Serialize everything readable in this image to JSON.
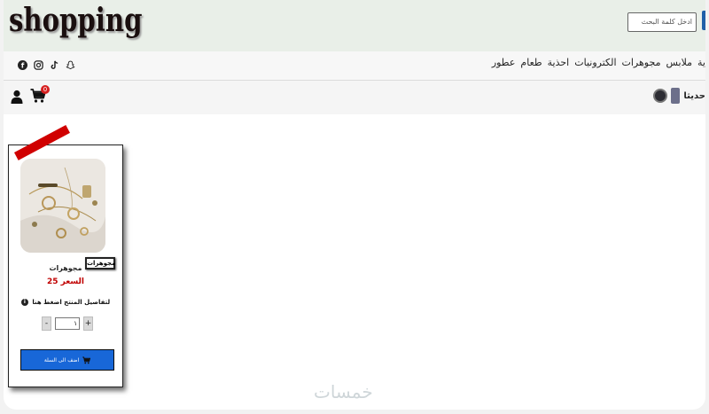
{
  "header": {
    "logo": "shopping",
    "search_placeholder": "ادخل كلمة البحث"
  },
  "nav": {
    "social": [
      "facebook-icon",
      "instagram-icon",
      "tiktok-icon",
      "snapchat-icon"
    ],
    "menu": [
      "ية",
      "ملابس",
      "مجوهرات",
      "الكترونيات",
      "احذية",
      "طعام",
      "عطور"
    ]
  },
  "userbar": {
    "cart_count": "0",
    "latest_label": "حديثا"
  },
  "product": {
    "category_tag": "مجوهرات",
    "name": "مجوهرات",
    "price_label": "السعر",
    "price": "25",
    "details_text": "لتفاصيل المنتج اضغط هنا",
    "qty_minus": "-",
    "qty_plus": "+",
    "qty_value": "١",
    "add_to_cart": "اضف الى السلة"
  },
  "watermark": "خمسات",
  "colors": {
    "header_bg": "#e9efe8",
    "add_cart_bg": "#1867d8",
    "price": "#c00000",
    "ribbon": "#d00000"
  }
}
